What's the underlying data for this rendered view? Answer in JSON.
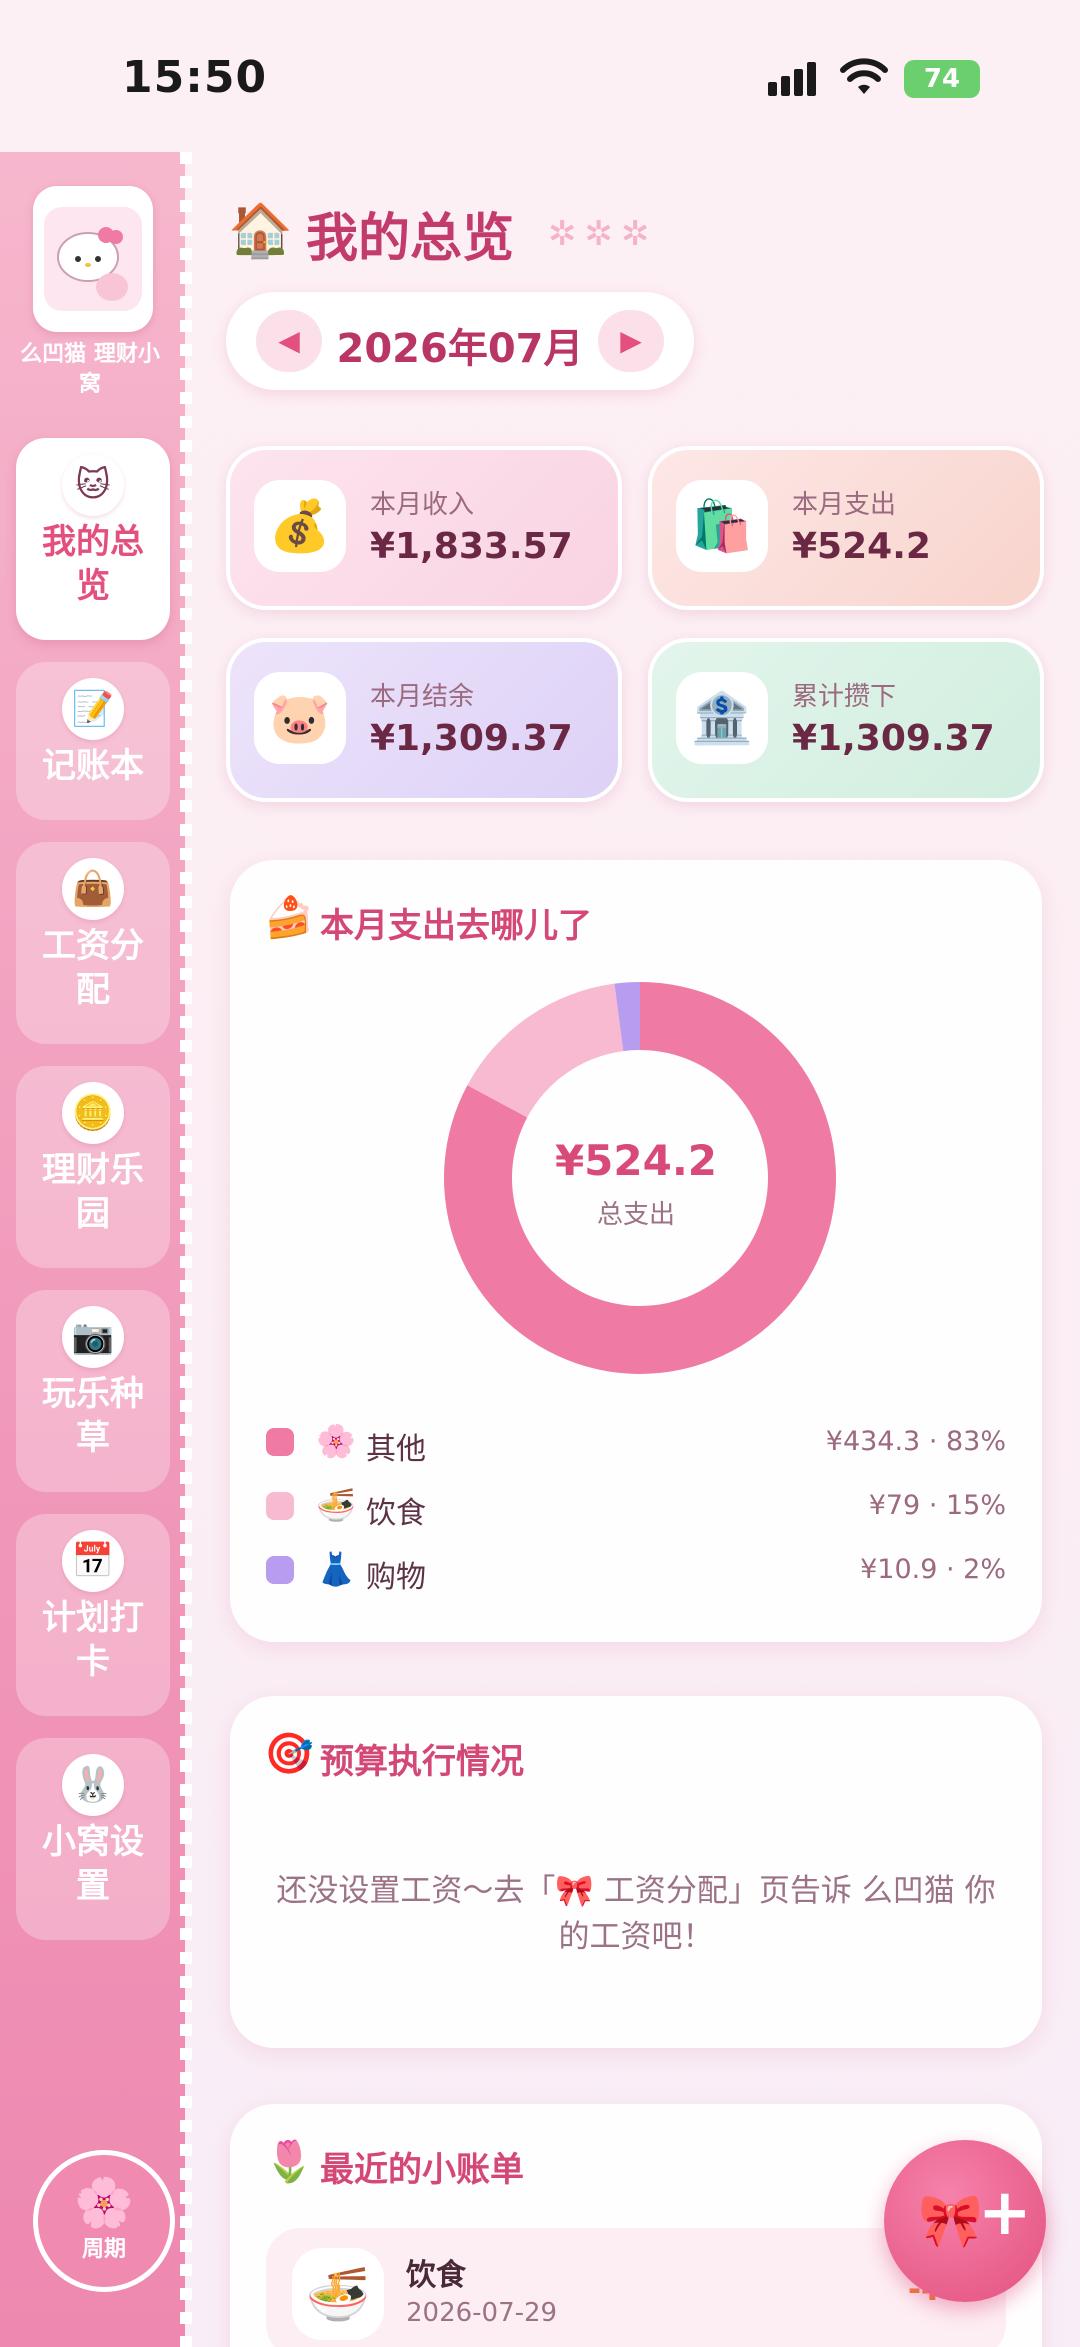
{
  "status": {
    "time": "15:50",
    "battery": "74"
  },
  "sidebar": {
    "app_name": "么凹猫 理财小窝",
    "items": [
      {
        "label": "我的总览",
        "icon": "kitty-icon"
      },
      {
        "label": "记账本",
        "icon": "notebook-icon"
      },
      {
        "label": "工资分配",
        "icon": "handbag-icon"
      },
      {
        "label": "理财乐园",
        "icon": "coin-icon"
      },
      {
        "label": "玩乐种草",
        "icon": "camera-icon"
      },
      {
        "label": "计划打卡",
        "icon": "checklist-icon"
      },
      {
        "label": "小窝设置",
        "icon": "settings-icon"
      }
    ],
    "period_label": "周期"
  },
  "header": {
    "title": "我的总览",
    "month": "2026年07月"
  },
  "stats": [
    {
      "label": "本月收入",
      "value": "¥1,833.57",
      "icon": "money-bag-icon"
    },
    {
      "label": "本月支出",
      "value": "¥524.2",
      "icon": "shopping-bag-icon"
    },
    {
      "label": "本月结余",
      "value": "¥1,309.37",
      "icon": "pig-icon"
    },
    {
      "label": "累计攒下",
      "value": "¥1,309.37",
      "icon": "bank-icon"
    }
  ],
  "expense_panel": {
    "title": "本月支出去哪儿了",
    "total": "¥524.2",
    "total_label": "总支出"
  },
  "chart_data": {
    "type": "pie",
    "categories": [
      "其他",
      "饮食",
      "购物"
    ],
    "values": [
      434.3,
      79,
      10.9
    ],
    "colors": [
      "#ef7ba5",
      "#f7bad0",
      "#b79cf0"
    ],
    "legend": [
      {
        "name": "其他",
        "value": "¥434.3 · 83%",
        "emoji": "🌸"
      },
      {
        "name": "饮食",
        "value": "¥79 · 15%",
        "emoji": "🍜"
      },
      {
        "name": "购物",
        "value": "¥10.9 · 2%",
        "emoji": "👗"
      }
    ]
  },
  "budget_panel": {
    "title": "预算执行情况",
    "empty_text": "还没设置工资～去「🎀 工资分配」页告诉 么凹猫 你的工资吧！"
  },
  "recent_panel": {
    "title": "最近的小账单",
    "bills": [
      {
        "name": "饮食",
        "date": "2026-07-29",
        "amount": "-¥79"
      }
    ]
  }
}
